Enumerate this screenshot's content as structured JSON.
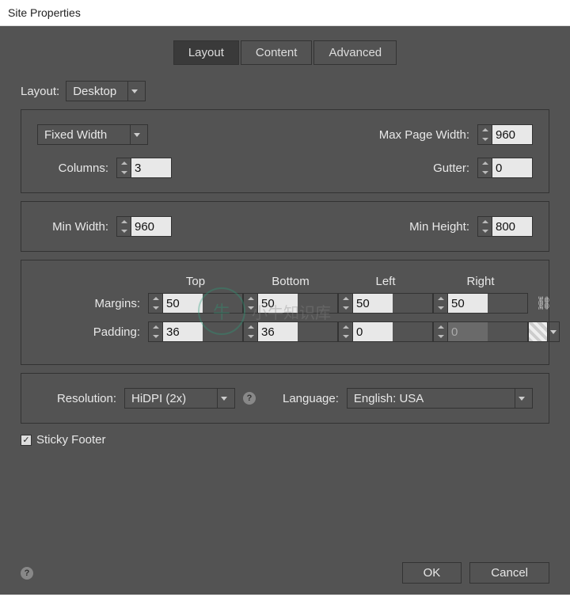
{
  "window": {
    "title": "Site Properties"
  },
  "tabs": {
    "layout": "Layout",
    "content": "Content",
    "advanced": "Advanced",
    "active": "layout"
  },
  "layoutSel": {
    "label": "Layout:",
    "value": "Desktop"
  },
  "group1": {
    "widthMode": "Fixed Width",
    "maxPageWidthLabel": "Max Page Width:",
    "maxPageWidth": "960",
    "columnsLabel": "Columns:",
    "columns": "3",
    "gutterLabel": "Gutter:",
    "gutter": "0"
  },
  "group2": {
    "minWidthLabel": "Min Width:",
    "minWidth": "960",
    "minHeightLabel": "Min Height:",
    "minHeight": "800"
  },
  "group3": {
    "headers": {
      "top": "Top",
      "bottom": "Bottom",
      "left": "Left",
      "right": "Right"
    },
    "marginsLabel": "Margins:",
    "margins": {
      "top": "50",
      "bottom": "50",
      "left": "50",
      "right": "50"
    },
    "paddingLabel": "Padding:",
    "padding": {
      "top": "36",
      "bottom": "36",
      "left": "0",
      "right": "0"
    }
  },
  "group4": {
    "resolutionLabel": "Resolution:",
    "resolution": "HiDPI (2x)",
    "languageLabel": "Language:",
    "language": "English: USA"
  },
  "stickyFooter": {
    "label": "Sticky Footer",
    "checked": true
  },
  "buttons": {
    "ok": "OK",
    "cancel": "Cancel"
  }
}
